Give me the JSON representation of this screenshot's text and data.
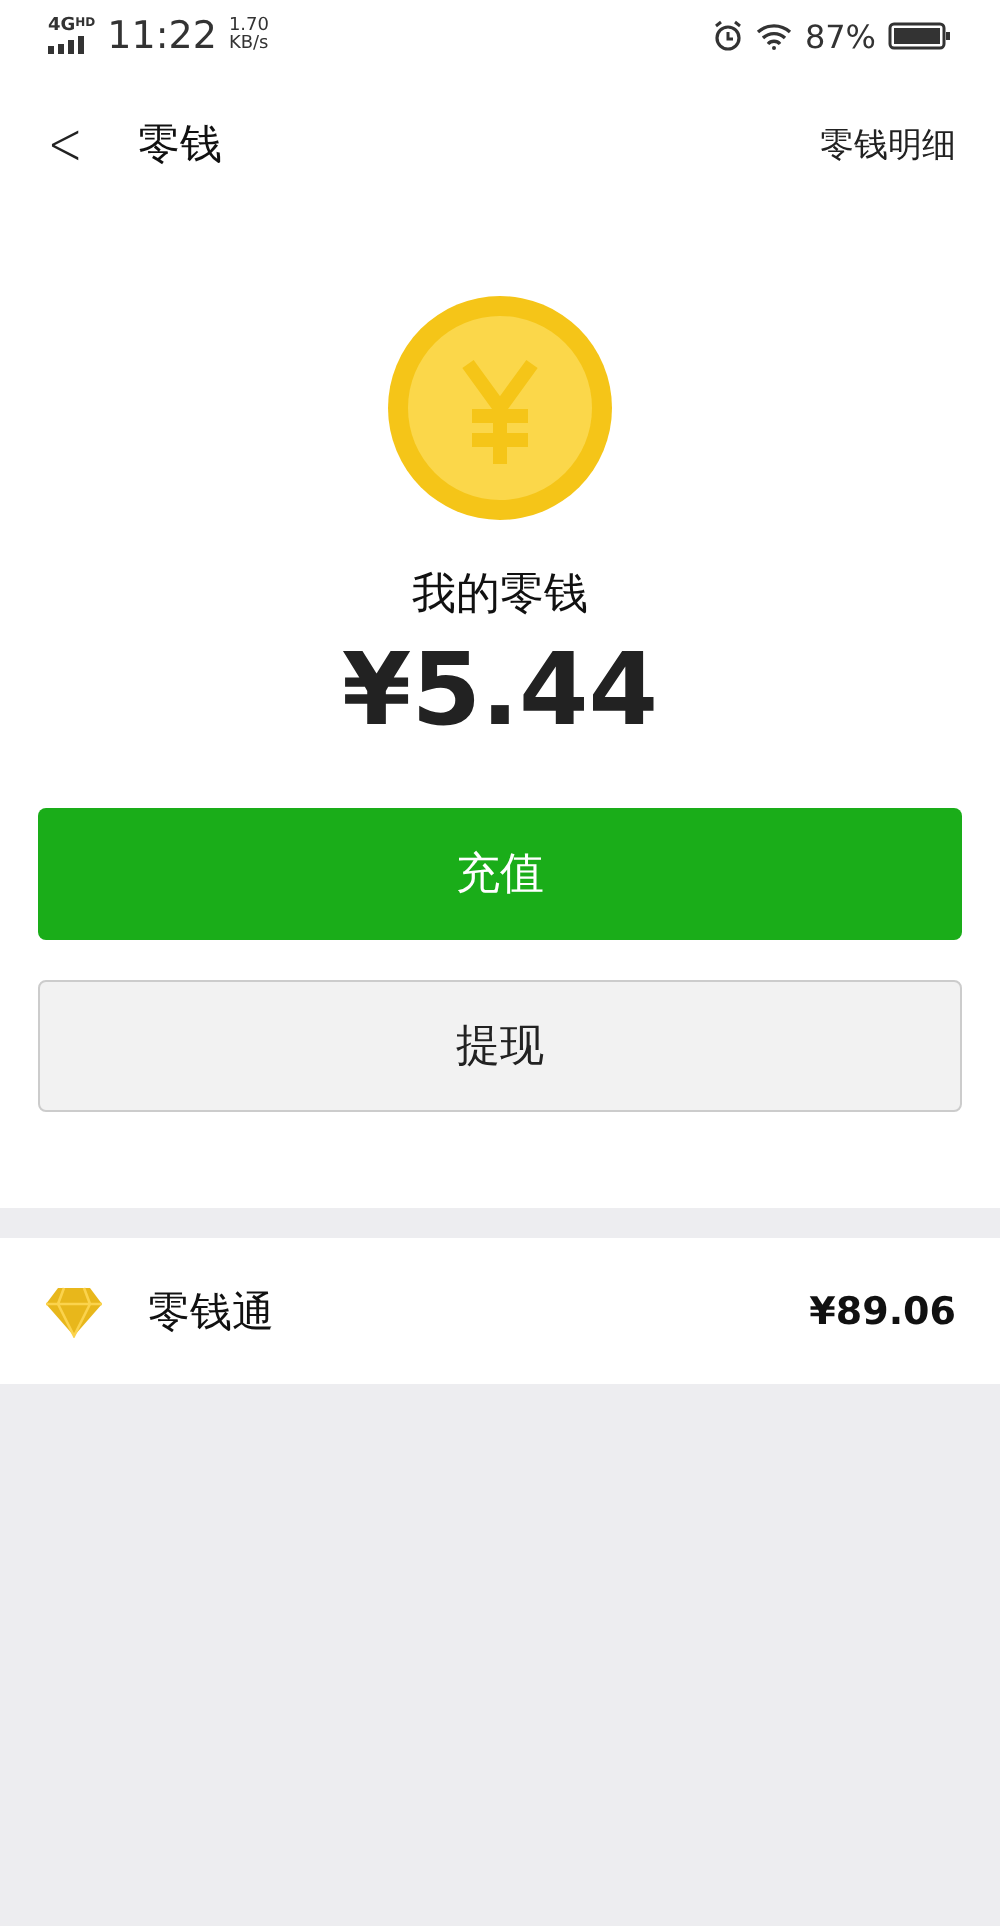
{
  "status_bar": {
    "network": "4G",
    "hd": "HD",
    "time": "11:22",
    "speed": "1.70",
    "speed_unit": "KB/s",
    "battery": "87%"
  },
  "header": {
    "back": "<",
    "title": "零钱",
    "action": "零钱明细"
  },
  "balance": {
    "label": "我的零钱",
    "amount": "¥5.44"
  },
  "buttons": [
    {
      "label": "充值",
      "kind": "primary"
    },
    {
      "label": "提现",
      "kind": "secondary"
    }
  ],
  "list": [
    {
      "label": "零钱通",
      "value": "¥89.06"
    }
  ]
}
